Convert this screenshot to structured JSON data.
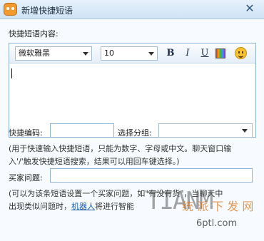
{
  "window": {
    "title": "新增快捷短语",
    "close_glyph": "✕"
  },
  "form": {
    "content_label": "快捷短语内容:",
    "toolbar": {
      "font_family": "微软雅黑",
      "font_size": "10",
      "bold": "B",
      "italic": "I",
      "underline": "U"
    },
    "editor_value": "",
    "code_label": "快捷编码:",
    "code_value": "",
    "group_label": "选择分组:",
    "group_value": "",
    "hint1_line1": "(用于快速输入快捷短语，只能为数字、字母或中文。聊天窗口输",
    "hint1_line2": "入'/'触发快捷短语搜索，结果可以用回车键选择。)",
    "buyer_q_label": "买家问题:",
    "buyer_q_value": "",
    "hint2_line1": "(可以为该条短语设置一个买家问题，如\"有没有货\"，当聊天中",
    "hint2_line2_a": "出现类似问题时，",
    "hint2_link": "机器人",
    "hint2_line2_b": "将进行智能"
  },
  "watermark": {
    "site": "TIANM",
    "cn": "统 派 下 发 网",
    "url": "6ptl.com"
  }
}
